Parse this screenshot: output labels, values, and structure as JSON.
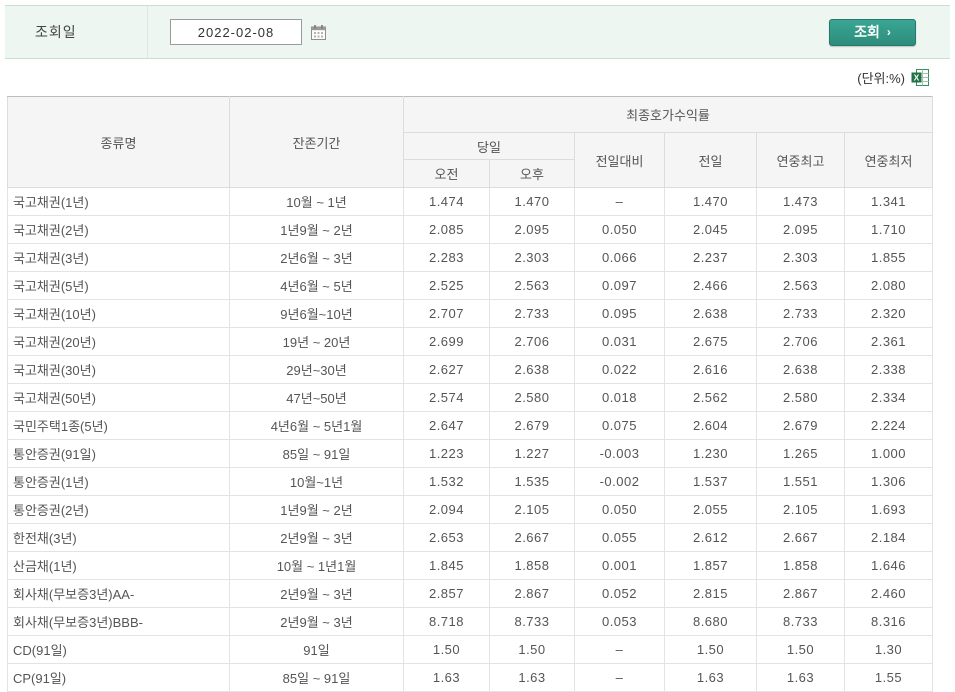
{
  "search_bar": {
    "date_label": "조회일",
    "date_value": "2022-02-08",
    "search_button_label": "조회",
    "search_button_arrow": "›"
  },
  "meta": {
    "unit_label": "(단위:%)"
  },
  "colors": {
    "up": "#c7402e",
    "down": "#3a46a8",
    "accent_teal": "#2e8c7b"
  },
  "table": {
    "headers": {
      "type": "종류명",
      "maturity": "잔존기간",
      "yield_group": "최종호가수익률",
      "today": "당일",
      "morning": "오전",
      "afternoon": "오후",
      "vs_prev": "전일대비",
      "prev": "전일",
      "year_high": "연중최고",
      "year_low": "연중최저"
    },
    "rows": [
      {
        "type": "국고채권(1년)",
        "maturity": "10월 ~ 1년",
        "am": "1.474",
        "am_c": "up",
        "pm": "1.470",
        "pm_c": "flat",
        "chg": "–",
        "chg_c": "flat",
        "prev": "1.470",
        "high": "1.473",
        "low": "1.341"
      },
      {
        "type": "국고채권(2년)",
        "maturity": "1년9월 ~ 2년",
        "am": "2.085",
        "am_c": "up",
        "pm": "2.095",
        "pm_c": "up",
        "chg": "0.050",
        "chg_c": "up",
        "prev": "2.045",
        "high": "2.095",
        "low": "1.710"
      },
      {
        "type": "국고채권(3년)",
        "maturity": "2년6월 ~ 3년",
        "am": "2.283",
        "am_c": "up",
        "pm": "2.303",
        "pm_c": "up",
        "chg": "0.066",
        "chg_c": "up",
        "prev": "2.237",
        "high": "2.303",
        "low": "1.855"
      },
      {
        "type": "국고채권(5년)",
        "maturity": "4년6월 ~ 5년",
        "am": "2.525",
        "am_c": "up",
        "pm": "2.563",
        "pm_c": "up",
        "chg": "0.097",
        "chg_c": "up",
        "prev": "2.466",
        "high": "2.563",
        "low": "2.080"
      },
      {
        "type": "국고채권(10년)",
        "maturity": "9년6월~10년",
        "am": "2.707",
        "am_c": "up",
        "pm": "2.733",
        "pm_c": "up",
        "chg": "0.095",
        "chg_c": "up",
        "prev": "2.638",
        "high": "2.733",
        "low": "2.320"
      },
      {
        "type": "국고채권(20년)",
        "maturity": "19년 ~ 20년",
        "am": "2.699",
        "am_c": "up",
        "pm": "2.706",
        "pm_c": "up",
        "chg": "0.031",
        "chg_c": "up",
        "prev": "2.675",
        "high": "2.706",
        "low": "2.361"
      },
      {
        "type": "국고채권(30년)",
        "maturity": "29년~30년",
        "am": "2.627",
        "am_c": "up",
        "pm": "2.638",
        "pm_c": "up",
        "chg": "0.022",
        "chg_c": "up",
        "prev": "2.616",
        "high": "2.638",
        "low": "2.338"
      },
      {
        "type": "국고채권(50년)",
        "maturity": "47년~50년",
        "am": "2.574",
        "am_c": "up",
        "pm": "2.580",
        "pm_c": "up",
        "chg": "0.018",
        "chg_c": "up",
        "prev": "2.562",
        "high": "2.580",
        "low": "2.334"
      },
      {
        "type": "국민주택1종(5년)",
        "maturity": "4년6월 ~ 5년1월",
        "am": "2.647",
        "am_c": "up",
        "pm": "2.679",
        "pm_c": "up",
        "chg": "0.075",
        "chg_c": "up",
        "prev": "2.604",
        "high": "2.679",
        "low": "2.224"
      },
      {
        "type": "통안증권(91일)",
        "maturity": "85일 ~ 91일",
        "am": "1.223",
        "am_c": "down",
        "pm": "1.227",
        "pm_c": "down",
        "chg": "-0.003",
        "chg_c": "down",
        "prev": "1.230",
        "high": "1.265",
        "low": "1.000"
      },
      {
        "type": "통안증권(1년)",
        "maturity": "10월~1년",
        "am": "1.532",
        "am_c": "down",
        "pm": "1.535",
        "pm_c": "down",
        "chg": "-0.002",
        "chg_c": "down",
        "prev": "1.537",
        "high": "1.551",
        "low": "1.306"
      },
      {
        "type": "통안증권(2년)",
        "maturity": "1년9월 ~ 2년",
        "am": "2.094",
        "am_c": "up",
        "pm": "2.105",
        "pm_c": "up",
        "chg": "0.050",
        "chg_c": "up",
        "prev": "2.055",
        "high": "2.105",
        "low": "1.693"
      },
      {
        "type": "한전채(3년)",
        "maturity": "2년9월 ~ 3년",
        "am": "2.653",
        "am_c": "up",
        "pm": "2.667",
        "pm_c": "up",
        "chg": "0.055",
        "chg_c": "up",
        "prev": "2.612",
        "high": "2.667",
        "low": "2.184"
      },
      {
        "type": "산금채(1년)",
        "maturity": "10월 ~ 1년1월",
        "am": "1.845",
        "am_c": "down",
        "pm": "1.858",
        "pm_c": "down",
        "chg": "0.001",
        "chg_c": "down",
        "prev": "1.857",
        "high": "1.858",
        "low": "1.646"
      },
      {
        "type": "회사채(무보증3년)AA-",
        "maturity": "2년9월 ~ 3년",
        "am": "2.857",
        "am_c": "up",
        "pm": "2.867",
        "pm_c": "up",
        "chg": "0.052",
        "chg_c": "up",
        "prev": "2.815",
        "high": "2.867",
        "low": "2.460"
      },
      {
        "type": "회사채(무보증3년)BBB-",
        "maturity": "2년9월 ~ 3년",
        "am": "8.718",
        "am_c": "up",
        "pm": "8.733",
        "pm_c": "up",
        "chg": "0.053",
        "chg_c": "up",
        "prev": "8.680",
        "high": "8.733",
        "low": "8.316"
      },
      {
        "type": "CD(91일)",
        "maturity": "91일",
        "am": "1.50",
        "am_c": "flat",
        "pm": "1.50",
        "pm_c": "flat",
        "chg": "–",
        "chg_c": "flat",
        "prev": "1.50",
        "high": "1.50",
        "low": "1.30"
      },
      {
        "type": "CP(91일)",
        "maturity": "85일 ~ 91일",
        "am": "1.63",
        "am_c": "flat",
        "pm": "1.63",
        "pm_c": "flat",
        "chg": "–",
        "chg_c": "flat",
        "prev": "1.63",
        "high": "1.63",
        "low": "1.55"
      }
    ]
  }
}
